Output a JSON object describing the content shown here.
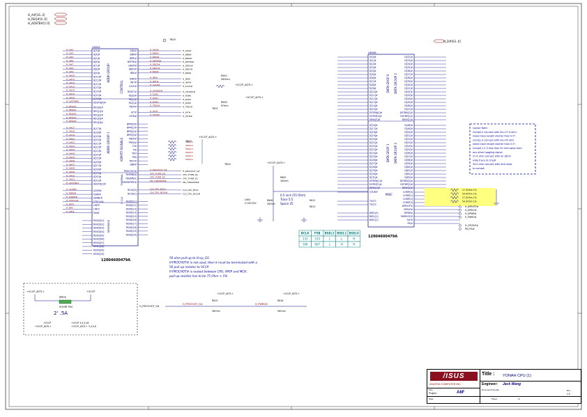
{
  "top_signals": [
    "H_A#[16..3]",
    "H_REQ#[4..0]",
    "H_ADSTB#[1:0]"
  ],
  "hdata_signal": "H_D#[63..0]",
  "u1a": {
    "ref": "U600A",
    "part": "12004600479A",
    "left_pins": [
      "A[3]#",
      "A[4]#",
      "A[5]#",
      "A[6]#",
      "A[7]#",
      "A[8]#",
      "A[9]#",
      "A[10]#",
      "A[11]#",
      "A[12]#",
      "A[13]#",
      "A[14]#",
      "A[15]#",
      "A[16]#",
      "ADSTB[0]#",
      "REQ[0]#",
      "REQ[1]#",
      "REQ[2]#",
      "REQ[3]#",
      "REQ[4]#",
      "A[17]#",
      "A[18]#",
      "A[19]#",
      "A[20]#",
      "A[21]#",
      "A[22]#",
      "A[23]#",
      "A[24]#",
      "A[25]#",
      "A[26]#",
      "A[27]#",
      "A[28]#",
      "A[29]#",
      "A[30]#",
      "A[31]#",
      "ADSTB[1]#",
      "A20M#",
      "FERR#",
      "IGNNE#",
      "STPCLK#",
      "LINT0",
      "LINT1",
      "SMI#",
      "RSVD[01]",
      "RSVD[02]",
      "RSVD[03]",
      "RSVD[04]",
      "RSVD[05]",
      "RSVD[06]",
      "RSVD[07]",
      "RSVD[08]",
      "RSVD[09]",
      "RSVD[10]"
    ],
    "right_pins": [
      "ADS#",
      "BNR#",
      "BPRI#",
      "DEFER#",
      "DRDY#",
      "DBSY#",
      "BR0#",
      "IERR#",
      "INIT#",
      "LOCK#",
      "RESET#",
      "RS[0]#",
      "RS[1]#",
      "RS[2]#",
      "TRDY#",
      "HIT#",
      "HITM#",
      "BPM[0]#",
      "BPM[1]#",
      "BPM[2]#",
      "BPM[3]#",
      "PRDY#",
      "PREQ#",
      "TCK",
      "TDI",
      "TDO",
      "TMS",
      "TRST#",
      "DBR#",
      "PROCHOT#",
      "THERMDA",
      "THERMDC",
      "THERMTRIP#",
      "BCLK[0]",
      "BCLK[1]",
      "RSVD[11]",
      "RSVD[12]",
      "RSVD[13]",
      "RSVD[14]",
      "RSVD[15]",
      "RSVD[16]",
      "RSVD[17]",
      "RSVD[18]",
      "RSVD[19]",
      "RSVD[20]"
    ],
    "groups": [
      "ADDR GROUP",
      "CONTROL",
      "ADDR GROUP 1",
      "XDP/ITP SIGNALS",
      "THERMAL",
      "H CLK",
      "RESERVED"
    ]
  },
  "u1b": {
    "ref": "U600B",
    "part": "12004600479A",
    "pins_top": [
      "D[0]#",
      "D[1]#",
      "D[2]#",
      "D[3]#",
      "D[4]#",
      "D[5]#",
      "D[6]#",
      "D[7]#",
      "D[8]#",
      "D[9]#",
      "D[10]#",
      "D[11]#",
      "D[12]#",
      "D[13]#",
      "D[14]#",
      "D[15]#",
      "DSTBN[0]#",
      "DSTBP[0]#",
      "DINV[0]#"
    ],
    "pins_mid": [
      "D[16]#",
      "D[17]#",
      "D[18]#",
      "D[19]#",
      "D[20]#",
      "D[21]#",
      "D[22]#",
      "D[23]#",
      "D[24]#",
      "D[25]#",
      "D[26]#",
      "D[27]#",
      "D[28]#",
      "D[29]#",
      "D[30]#",
      "D[31]#",
      "DSTBN[1]#",
      "DSTBP[1]#",
      "DINV[1]#"
    ],
    "pins_right_top": [
      "D[32]#",
      "D[33]#",
      "D[34]#",
      "D[35]#",
      "D[36]#",
      "D[37]#",
      "D[38]#",
      "D[39]#",
      "D[40]#",
      "D[41]#",
      "D[42]#",
      "D[43]#",
      "D[44]#",
      "D[45]#",
      "D[46]#",
      "D[47]#",
      "DSTBN[2]#",
      "DSTBP[2]#",
      "DINV[2]#"
    ],
    "pins_right_mid": [
      "D[48]#",
      "D[49]#",
      "D[50]#",
      "D[51]#",
      "D[52]#",
      "D[53]#",
      "D[54]#",
      "D[55]#",
      "D[56]#",
      "D[57]#",
      "D[58]#",
      "D[59]#",
      "D[60]#",
      "D[61]#",
      "D[62]#",
      "D[63]#",
      "DSTBN[3]#",
      "DSTBP[3]#",
      "DINV[3]#"
    ],
    "misc_left": [
      "GTLREF",
      "TEST1",
      "TEST2",
      "BSEL[0]",
      "BSEL[1]",
      "BSEL[2]"
    ],
    "misc_right": [
      "COMP[0]",
      "COMP[1]",
      "COMP[2]",
      "COMP[3]",
      "DPRSTP#",
      "DPSLP#",
      "DPWR#",
      "PWRGOOD",
      "SLP#",
      "PSI#"
    ],
    "groups": [
      "DATA GROP 0",
      "DATA GROP 1",
      "DATA GROUP 2",
      "DATA GROUP 3",
      "MISC"
    ]
  },
  "left_nets": [
    "H_A#3",
    "H_A#4",
    "H_A#5",
    "H_A#6",
    "H_A#7",
    "H_A#8",
    "H_A#9",
    "H_A#10",
    "H_A#11",
    "H_A#12",
    "H_A#13",
    "H_A#14",
    "H_A#15",
    "H_A#16",
    "H_ADSTB#0",
    "H_REQ#0",
    "H_REQ#1",
    "H_REQ#2",
    "H_REQ#3",
    "H_REQ#4",
    "H_A#17",
    "H_A#18",
    "H_A#19",
    "H_A#20",
    "H_A#21",
    "H_A#22",
    "H_A#23",
    "H_A#24",
    "H_A#25",
    "H_A#26",
    "H_A#27",
    "H_A#28",
    "H_A#29",
    "H_A#30",
    "H_A#31",
    "H_ADSTB#1",
    "H_A20M#",
    "H_FERR#",
    "H_IGNNE#",
    "H_STPCLK#",
    "H_INTR",
    "H_NMI",
    "H_SMI#"
  ],
  "mid_nets": [
    "H_ADS#",
    "H_BNR#",
    "H_BPRI#",
    "H_DEFER#",
    "H_DRDY#",
    "H_DBSY#",
    "H_BR0#",
    "H_IERR",
    "H_INIT#",
    "H_LOCK#",
    "H_CPURST#",
    "H_RS#0",
    "H_RS#1",
    "H_RS#2",
    "H_TRDY#",
    "H_HIT#",
    "H_HITM#",
    "H_PROCHOT_S#",
    "CPU_THRM_DA",
    "CPU_THRM_DC",
    "PM_THRMTRIP#",
    "CLK_CPU_BCLK",
    "CLK_CPU_BCLK#"
  ],
  "passives": [
    {
      "ref": "R601",
      "value": "56Ohm"
    },
    {
      "ref": "R602",
      "value": "0Ohm"
    },
    {
      "ref": "R603",
      "value": "0Ohm"
    },
    {
      "ref": "T600",
      "value": ""
    },
    {
      "ref": "T601",
      "value": ""
    },
    {
      "ref": "T602",
      "value": ""
    },
    {
      "ref": "T603",
      "value": ""
    },
    {
      "ref": "T604",
      "value": ""
    },
    {
      "ref": "R605",
      "value": "1KOhm"
    },
    {
      "ref": "R606",
      "value": "2KOhm"
    },
    {
      "ref": "C605",
      "value": "0.1UF/10V"
    },
    {
      "ref": "R612",
      "value": "1KOhm"
    },
    {
      "ref": "R613",
      "value": "1KOhm"
    },
    {
      "ref": "R615",
      "value": "56Ohm"
    },
    {
      "ref": "R616",
      "value": "56Ohm"
    },
    {
      "ref": "JP600",
      "value": "SHORT_PIN"
    }
  ],
  "vcc": "+VCCP_AGTL+",
  "vccp": "+VCCP",
  "gtlref_note": [
    "0.5 inch (55 Ohm)",
    "Trace 5:5",
    "Space 25"
  ],
  "bsel_table": {
    "headers": [
      "BCLK",
      "FSB",
      "BSEL2",
      "BSEL1",
      "BSEL0"
    ],
    "rows": [
      [
        "133",
        "533",
        "L",
        "L",
        "H"
      ],
      [
        "166",
        "667",
        "L",
        "H",
        "H"
      ]
    ]
  },
  "comp_nets": [
    "27.4Ohm 1%",
    "54.9Ohm 1%",
    "27.4Ohm 1%",
    "54.9Ohm 1%"
  ],
  "right_ctrl_nets": [
    "H_DPRSTP#",
    "H_DPSLP#",
    "H_DPWR#",
    "H_PWRGD",
    "H_CPUSLP#",
    "PM_PSI#"
  ],
  "layout_note": [
    "Layout Note:",
    "Comp0,2 connect with Zo=27.4 ohm",
    "make trace length shorter than 0.5\".",
    "Comp1,3 connect with Zo=55 ohm",
    "make trace length shorter than 0.5\".",
    "Comp0,1,2,3 less than 50 mils away from",
    "any other toggling signal.",
    "27.4 ohm connect with w/ 18mil",
    "wide trace to cmp#",
    "54.9 ohm connect with 4mil wide",
    "to comp#."
  ],
  "pullup_note": [
    "56 ohm pull-up to Vccp_GS",
    "If PROCHOT# is not used, then it must be terminated with a",
    "56 pull-up resistor to VCCP.",
    "If PROCHOT# is routed between CPU, IMVP and MCH,",
    "pull-up resistor has to be 75 Ohm +-5%"
  ],
  "power_box": {
    "label": "JP600",
    "value": "SHORT PIN",
    "vcc_left": "+VCCP_AGTL+",
    "vcc_right": "+VCCP",
    "nets_a": "+VCCP 3,4,5,26",
    "nets_b": "+VCCP_AGTL+ 3,4,5,6"
  },
  "bottom_nets": [
    "H_PROCHOT_S#",
    "H_PROCHOT_S#",
    "H_PWRGD"
  ],
  "titleblock": {
    "title_label": "Title :",
    "title": "YONAH CPU (1)",
    "engineer_label": "Engineer:",
    "engineer": "Jack Wang",
    "company": "ASUSTeK COMPUTER INC",
    "project_label": "Project",
    "project": "A6F",
    "rev_label": "Rev",
    "rev": "1.0",
    "size_label": "Size",
    "doc_label": "Document Number",
    "date_label": "Date:",
    "sheet_label": "Sheet",
    "of_label": "of"
  },
  "colors": {
    "wire": "#000080",
    "net": "#8b0000",
    "pin": "#000080",
    "highlight": "#ffff80",
    "box": "#0000a0",
    "table_header": "#008080"
  }
}
